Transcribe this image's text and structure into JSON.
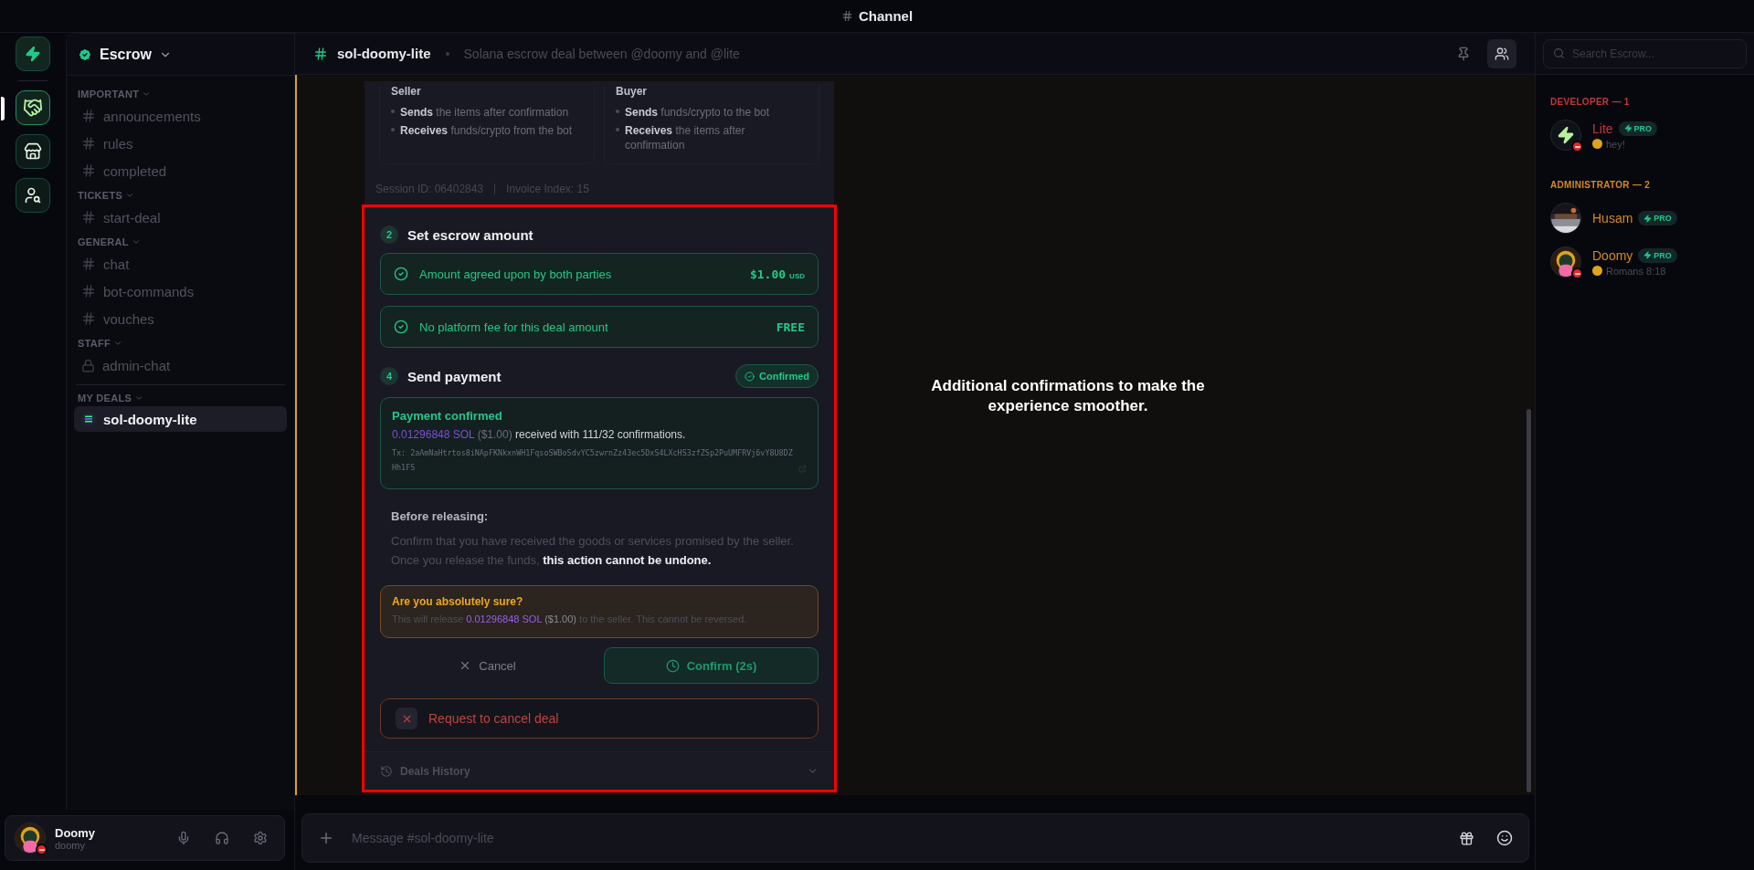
{
  "window": {
    "title": "Channel"
  },
  "servers": [
    {
      "kind": "home",
      "selected": false
    },
    {
      "kind": "handshake",
      "selected": true
    },
    {
      "kind": "store",
      "selected": false
    },
    {
      "kind": "detective",
      "selected": false
    }
  ],
  "server_header": {
    "name": "Escrow"
  },
  "channel_groups": [
    {
      "label": "IMPORTANT",
      "channels": [
        {
          "name": "announcements",
          "kind": "text",
          "selected": false
        },
        {
          "name": "rules",
          "kind": "text",
          "selected": false
        },
        {
          "name": "completed",
          "kind": "text",
          "selected": false
        }
      ]
    },
    {
      "label": "TICKETS",
      "channels": [
        {
          "name": "start-deal",
          "kind": "text",
          "selected": false
        }
      ]
    },
    {
      "label": "GENERAL",
      "channels": [
        {
          "name": "chat",
          "kind": "text",
          "selected": false
        },
        {
          "name": "bot-commands",
          "kind": "text",
          "selected": false
        },
        {
          "name": "vouches",
          "kind": "text",
          "selected": false
        }
      ]
    },
    {
      "label": "STAFF",
      "channels": [
        {
          "name": "admin-chat",
          "kind": "locked",
          "selected": false
        }
      ]
    },
    {
      "label": "MY DEALS",
      "channels": [
        {
          "name": "sol-doomy-lite",
          "kind": "deal",
          "selected": true
        }
      ]
    }
  ],
  "user_panel": {
    "name": "Doomy",
    "username": "doomy"
  },
  "channel_header": {
    "name": "sol-doomy-lite",
    "topic": "Solana escrow deal between @doomy and @lite",
    "buttons": [
      {
        "kind": "pin",
        "selected": false
      },
      {
        "kind": "members",
        "selected": true
      }
    ]
  },
  "deal_card": {
    "roles": [
      {
        "title": "Seller",
        "items": [
          "**Sends** the items after confirmation",
          "**Receives** funds/crypto from the bot"
        ]
      },
      {
        "title": "Buyer",
        "items": [
          "**Sends** funds/crypto to the bot",
          "**Receives** the items after confirmation"
        ]
      }
    ],
    "session": [
      "Session ID: 06402843",
      "Invoice Index: 15"
    ],
    "amount_step": {
      "number": "2",
      "title": "Set escrow amount"
    },
    "checks": [
      {
        "text": "Amount agreed upon by both parties",
        "value": "$1.00",
        "unit": "USD"
      },
      {
        "text": "No platform fee for this deal amount",
        "value": "FREE"
      }
    ],
    "payment_step": {
      "number": "4",
      "title": "Send payment",
      "badge": "Confirmed"
    },
    "payment": {
      "title": "Payment confirmed",
      "amount": "0.01296848 SOL",
      "fiat": "($1.00)",
      "text": "received with 111/32 confirmations.",
      "tx": "Tx: 2aAmNaHtrtos8iNApFKNkxnWH1FqsoSWBoSdvYC5zwrnZz43ec5DxS4LXcHS3zfZSp2PuUMFRVj6vY8U8DZHh1FS"
    },
    "before": {
      "title": "Before releasing:",
      "text": "Confirm that you have received the goods or services promised by the seller. Once you release the funds, **this action cannot be undone.**"
    },
    "warning": {
      "title": "Are you absolutely sure?",
      "prefix": "This will release",
      "amount": "0.01296848 SOL",
      "fiat": "($1.00)",
      "suffix": "to the seller. This cannot be reversed."
    },
    "cancel_button": "Cancel",
    "confirm_button": {
      "label": "Confirm (2s)",
      "disabled": true
    },
    "cancel_deal_button": "Request to cancel deal",
    "history": {
      "label": "Deals History",
      "expanded": false
    }
  },
  "annotation": "Additional confirmations to make the experience smoother.",
  "composer": {
    "placeholder": "Message #sol-doomy-lite"
  },
  "member_search": {
    "placeholder": "Search Escrow..."
  },
  "member_groups": [
    {
      "label": "DEVELOPER — 1",
      "color": "#c0393b",
      "members": [
        {
          "name": "Lite",
          "badge": "PRO",
          "status": "hey!",
          "kind": "bolt",
          "dnd": true
        }
      ]
    },
    {
      "label": "ADMINISTRATOR — 2",
      "color": "#d68a1c",
      "members": [
        {
          "name": "Husam",
          "badge": "PRO",
          "dnd": false
        },
        {
          "name": "Doomy",
          "badge": "PRO",
          "status": "Romans 8:18",
          "kind": "character",
          "dnd": true
        }
      ]
    }
  ]
}
